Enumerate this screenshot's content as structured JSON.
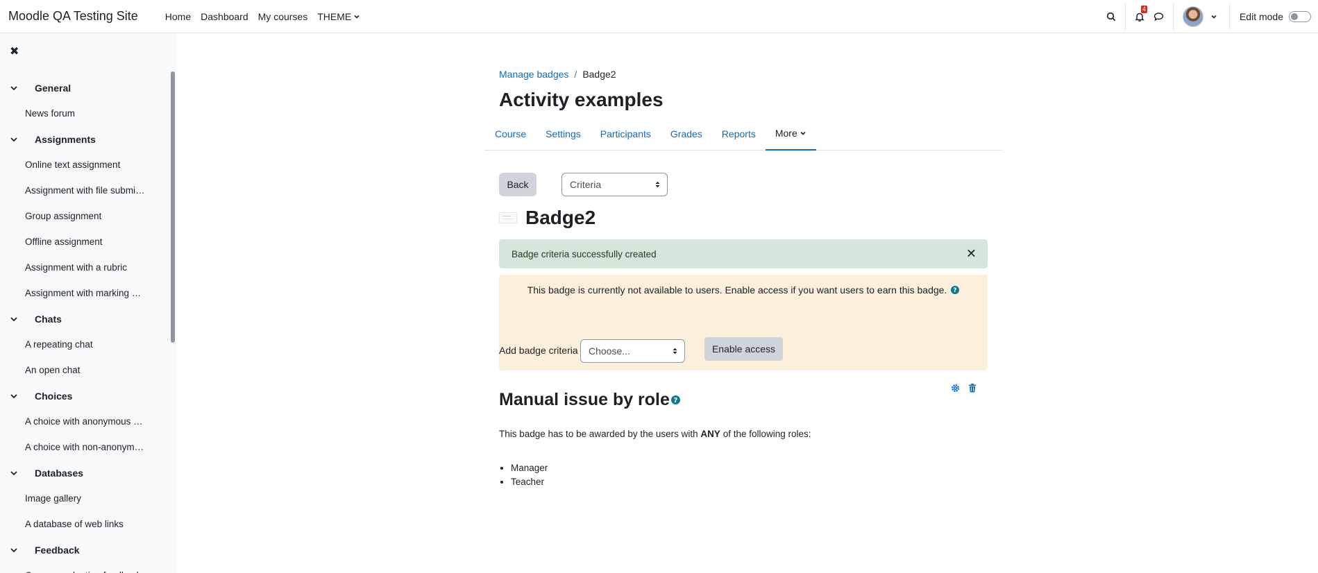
{
  "navbar": {
    "site_name": "Moodle QA Testing Site",
    "primary_nav": [
      "Home",
      "Dashboard",
      "My courses",
      "THEME"
    ],
    "notification_count": "4",
    "edit_mode_label": "Edit mode",
    "edit_mode_on": false
  },
  "drawer": {
    "close_icon": "close-icon",
    "sections": [
      {
        "title": "General",
        "items": [
          "News forum"
        ]
      },
      {
        "title": "Assignments",
        "items": [
          "Online text assignment",
          "Assignment with file submi…",
          "Group assignment",
          "Offline assignment",
          "Assignment with a rubric",
          "Assignment with marking …"
        ]
      },
      {
        "title": "Chats",
        "items": [
          "A repeating chat",
          "An open chat"
        ]
      },
      {
        "title": "Choices",
        "items": [
          "A choice with anonymous …",
          "A choice with non-anonym…"
        ]
      },
      {
        "title": "Databases",
        "items": [
          "Image gallery",
          "A database of web links"
        ]
      },
      {
        "title": "Feedback",
        "items": [
          "Course evaluation feedback"
        ]
      }
    ]
  },
  "breadcrumb": {
    "items": [
      "Manage badges",
      "Badge2"
    ],
    "separator": "/"
  },
  "page": {
    "title": "Activity examples"
  },
  "secondary_nav": {
    "tabs": [
      "Course",
      "Settings",
      "Participants",
      "Grades",
      "Reports"
    ],
    "more_label": "More"
  },
  "toolbar": {
    "back_label": "Back",
    "criteria_select_value": "Criteria"
  },
  "badge": {
    "name": "Badge2"
  },
  "alerts": {
    "success_message": "Badge criteria successfully created",
    "warning_message": "This badge is currently not available to users. Enable access if you want users to earn this badge.",
    "enable_access_label": "Enable access"
  },
  "add_criteria": {
    "label": "Add badge criteria",
    "select_value": "Choose..."
  },
  "criterion": {
    "title": "Manual issue by role",
    "description_before": "This badge has to be awarded by the users with ",
    "description_bold": "ANY",
    "description_after": " of the following roles:",
    "roles": [
      "Manager",
      "Teacher"
    ]
  },
  "colors": {
    "link": "#0f6cbf",
    "success_bg": "#d7e6da",
    "warning_bg": "#fcefdc",
    "button_secondary": "#ced4da",
    "drawer_bg": "#f8f9fa"
  }
}
